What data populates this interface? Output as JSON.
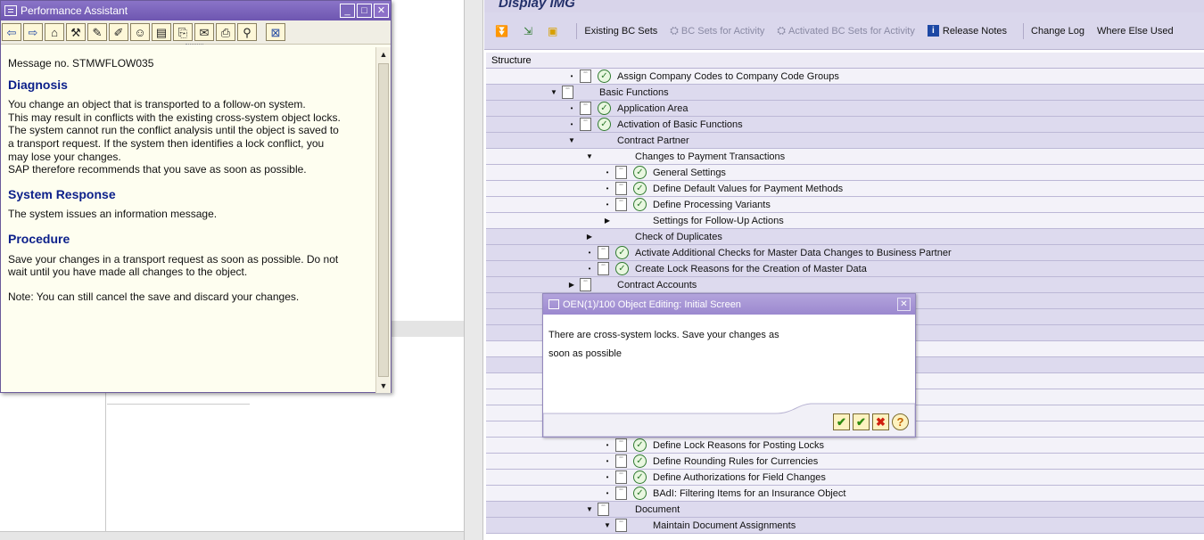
{
  "performance_assistant": {
    "title": "Performance Assistant",
    "message_no": "Message no. STMWFLOW035",
    "sections": {
      "diagnosis_heading": "Diagnosis",
      "diagnosis_lines": [
        "You change an object that is transported to a follow-on system.",
        "This may result in conflicts with the existing cross-system object locks.",
        "The system cannot run the conflict analysis until the object is saved to",
        "a transport request. If the system then identifies a lock conflict, you",
        "may lose your changes.",
        "SAP therefore recommends that you save as soon as possible."
      ],
      "response_heading": "System Response",
      "response_text": "The system issues an information message.",
      "procedure_heading": "Procedure",
      "procedure_lines": [
        "Save your changes in a transport request as soon as possible. Do not",
        "wait until you have made all changes to the object."
      ],
      "note": "Note: You can still cancel the save and discard your changes."
    }
  },
  "img": {
    "title": "Display IMG",
    "toolbar": {
      "existing_bc_sets": "Existing BC Sets",
      "bc_sets_activity": "BC Sets for Activity",
      "activated_bc_sets": "Activated BC Sets for Activity",
      "release_notes": "Release Notes",
      "change_log": "Change Log",
      "where_else_used": "Where Else Used"
    },
    "structure_header": "Structure",
    "tree": [
      {
        "label": "Assign Company Codes to Company Code Groups",
        "exp": "•",
        "node": true,
        "clock": true,
        "level": 0,
        "shade": "w"
      },
      {
        "label": "Basic Functions",
        "exp": "▼",
        "node": true,
        "clock": false,
        "level": -1,
        "shade": "d"
      },
      {
        "label": "Application Area",
        "exp": "•",
        "node": true,
        "clock": true,
        "level": 0,
        "shade": "d"
      },
      {
        "label": "Activation of Basic Functions",
        "exp": "•",
        "node": true,
        "clock": true,
        "level": 0,
        "shade": "d"
      },
      {
        "label": "Contract Partner",
        "exp": "▼",
        "node": false,
        "clock": false,
        "level": 0,
        "shade": "d"
      },
      {
        "label": "Changes to Payment Transactions",
        "exp": "▼",
        "node": false,
        "clock": false,
        "level": 1,
        "shade": "w"
      },
      {
        "label": "General Settings",
        "exp": "•",
        "node": true,
        "clock": true,
        "level": 2,
        "shade": "w"
      },
      {
        "label": "Define Default Values for Payment Methods",
        "exp": "•",
        "node": true,
        "clock": true,
        "level": 2,
        "shade": "w"
      },
      {
        "label": "Define Processing Variants",
        "exp": "•",
        "node": true,
        "clock": true,
        "level": 2,
        "shade": "w"
      },
      {
        "label": "Settings for Follow-Up Actions",
        "exp": "▶",
        "node": false,
        "clock": false,
        "level": 2,
        "shade": "w"
      },
      {
        "label": "Check of Duplicates",
        "exp": "▶",
        "node": false,
        "clock": false,
        "level": 1,
        "shade": "d"
      },
      {
        "label": "Activate Additional Checks for Master Data Changes to Business Partner",
        "exp": "•",
        "node": true,
        "clock": true,
        "level": 1,
        "shade": "d"
      },
      {
        "label": "Create Lock Reasons for the Creation of Master Data",
        "exp": "•",
        "node": true,
        "clock": true,
        "level": 1,
        "shade": "d"
      },
      {
        "label": "Contract Accounts",
        "exp": "▶",
        "node": true,
        "clock": false,
        "level": 0,
        "shade": "d"
      },
      {
        "label": "",
        "exp": "",
        "node": false,
        "clock": false,
        "level": 0,
        "shade": "d"
      },
      {
        "label": "",
        "exp": "",
        "node": false,
        "clock": false,
        "level": 0,
        "shade": "d"
      },
      {
        "label": "",
        "exp": "",
        "node": false,
        "clock": false,
        "level": 0,
        "shade": "d"
      },
      {
        "label": "",
        "exp": "",
        "node": false,
        "clock": false,
        "level": 0,
        "shade": "w"
      },
      {
        "label": "",
        "exp": "",
        "node": false,
        "clock": false,
        "level": 0,
        "shade": "d"
      },
      {
        "label": "",
        "exp": "",
        "node": false,
        "clock": false,
        "level": 0,
        "shade": "w"
      },
      {
        "label": "",
        "exp": "",
        "node": false,
        "clock": false,
        "level": 0,
        "shade": "w"
      },
      {
        "label": "",
        "exp": "",
        "node": false,
        "clock": false,
        "level": 0,
        "shade": "w"
      },
      {
        "label": "",
        "exp": "",
        "node": false,
        "clock": false,
        "level": 0,
        "shade": "w"
      },
      {
        "label": "Define Lock Reasons for Posting Locks",
        "exp": "•",
        "node": true,
        "clock": true,
        "level": 2,
        "shade": "w"
      },
      {
        "label": "Define Rounding Rules for Currencies",
        "exp": "•",
        "node": true,
        "clock": true,
        "level": 2,
        "shade": "w"
      },
      {
        "label": "Define Authorizations for Field Changes",
        "exp": "•",
        "node": true,
        "clock": true,
        "level": 2,
        "shade": "w"
      },
      {
        "label": "BAdI: Filtering Items for an Insurance Object",
        "exp": "•",
        "node": true,
        "clock": true,
        "level": 2,
        "shade": "w"
      },
      {
        "label": "Document",
        "exp": "▼",
        "node": true,
        "clock": false,
        "level": 1,
        "shade": "d"
      },
      {
        "label": "Maintain Document Assignments",
        "exp": "▼",
        "node": true,
        "clock": false,
        "level": 2,
        "shade": "d"
      }
    ]
  },
  "dialog": {
    "title": "OEN(1)/100 Object Editing: Initial Screen",
    "line1": "There are cross-system locks. Save your changes as",
    "line2": "soon as possible"
  },
  "colors": {
    "title_purple": "#6e56b0",
    "heading_blue": "#0b1f8a",
    "tree_shade": "#dddaee",
    "help_bg": "#fefef0"
  }
}
